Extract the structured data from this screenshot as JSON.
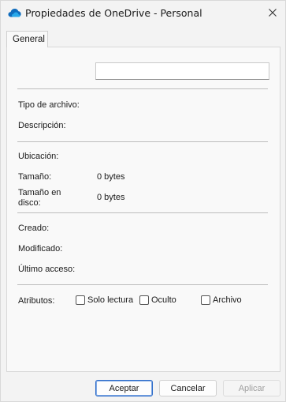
{
  "window": {
    "title": "Propiedades de OneDrive - Personal",
    "accent_color": "#0f6cbd"
  },
  "tabs": [
    {
      "label": "General"
    }
  ],
  "name_field": {
    "value": ""
  },
  "fields": {
    "file_type": {
      "label": "Tipo de archivo:",
      "value": ""
    },
    "description": {
      "label": "Descripción:",
      "value": ""
    },
    "location": {
      "label": "Ubicación:",
      "value": ""
    },
    "size": {
      "label": "Tamaño:",
      "value": "0 bytes"
    },
    "size_on_disk": {
      "label_line1": "Tamaño en",
      "label_line2": "disco:",
      "value": "0 bytes"
    },
    "created": {
      "label": "Creado:",
      "value": ""
    },
    "modified": {
      "label": "Modificado:",
      "value": ""
    },
    "accessed": {
      "label": "Último acceso:",
      "value": ""
    }
  },
  "attributes": {
    "label": "Atributos:",
    "options": [
      {
        "label": "Solo lectura",
        "checked": false
      },
      {
        "label": "Oculto",
        "checked": false
      },
      {
        "label": "Archivo",
        "checked": false
      }
    ]
  },
  "buttons": {
    "ok": "Aceptar",
    "cancel": "Cancelar",
    "apply": "Aplicar"
  },
  "icons": {
    "app": "onedrive-cloud-icon",
    "close": "close-icon"
  }
}
